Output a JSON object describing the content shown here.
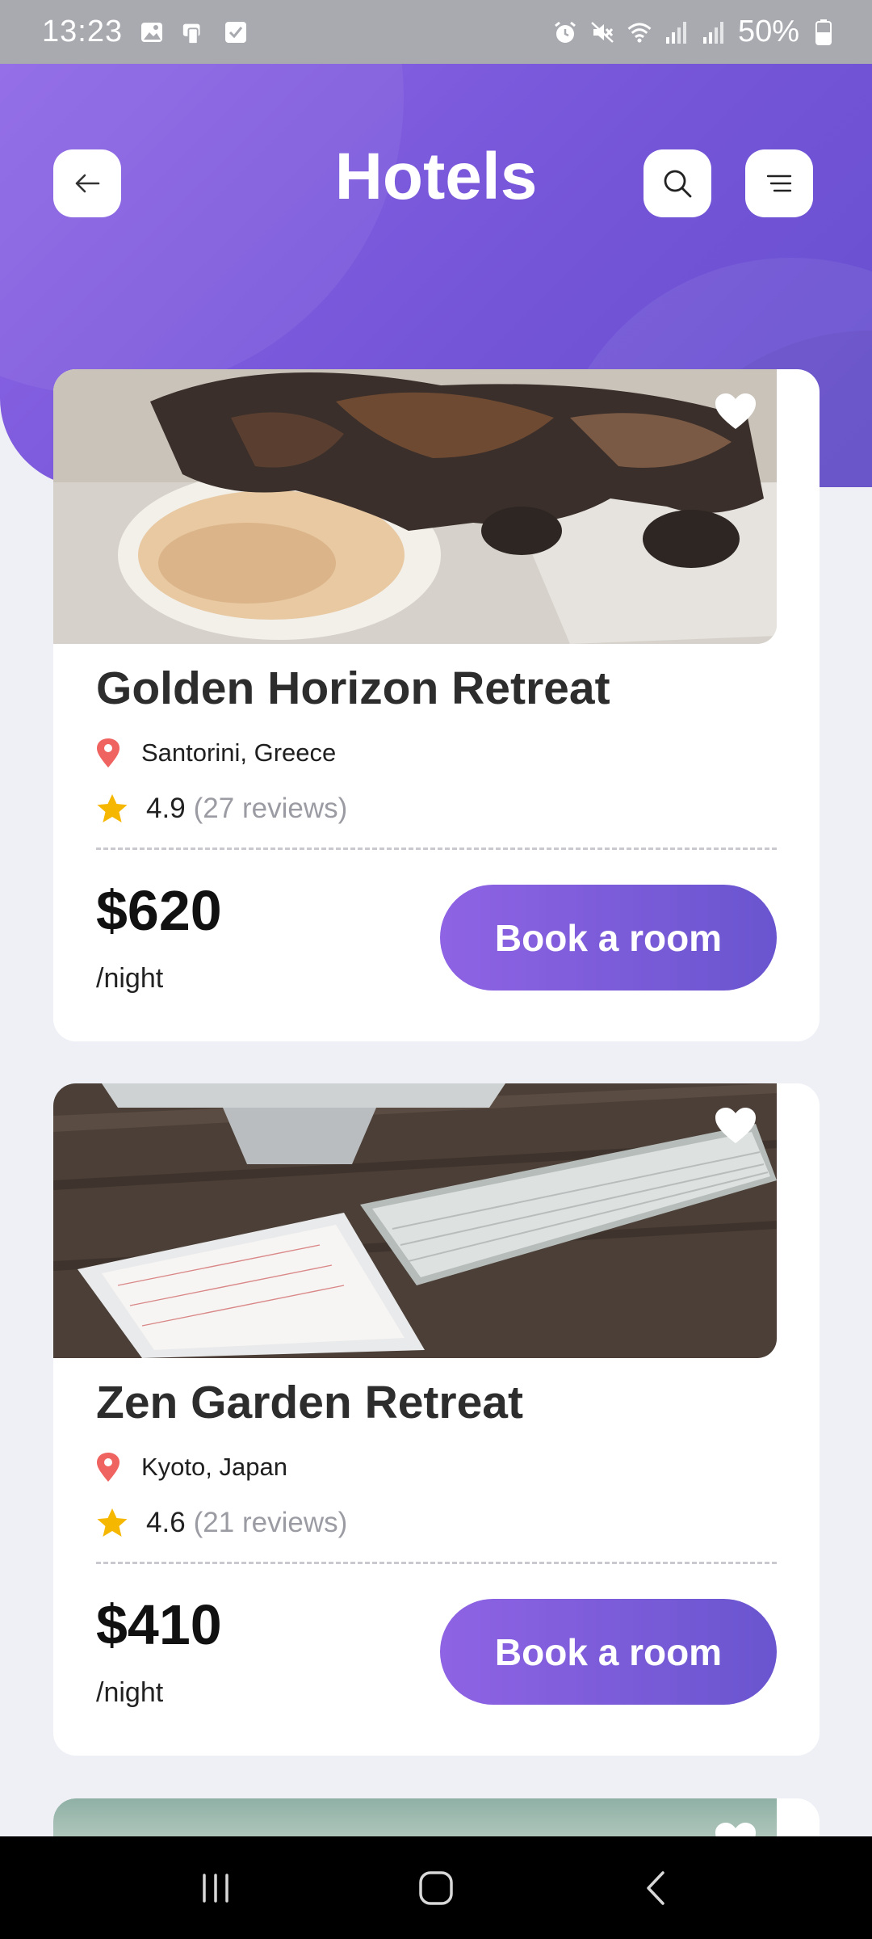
{
  "status_bar": {
    "time": "13:23",
    "battery": "50%",
    "left_icons": [
      "image-icon",
      "sim-card-icon",
      "checkbox-icon"
    ],
    "right_icons": [
      "alarm-icon",
      "mute-icon",
      "wifi-icon",
      "signal-icon",
      "signal-icon",
      "battery-icon"
    ]
  },
  "header": {
    "title": "Hotels",
    "back_icon": "arrow-left-icon",
    "search_icon": "search-icon",
    "menu_icon": "menu-icon",
    "gradient_colors": [
      "#8e66e6",
      "#6650cf"
    ]
  },
  "hotels": [
    {
      "name": "Golden Horizon Retreat",
      "location": "Santorini, Greece",
      "rating": "4.9",
      "reviews": "(27 reviews)",
      "price": "$620",
      "per": "/night",
      "cta": "Book a room",
      "image": "kitten eating from plate photo",
      "favorite": true
    },
    {
      "name": "Zen Garden Retreat",
      "location": "Kyoto, Japan",
      "rating": "4.6",
      "reviews": "(21 reviews)",
      "price": "$410",
      "per": "/night",
      "cta": "Book a room",
      "image": "tablet calendar and keyboard on desk photo",
      "favorite": true
    }
  ],
  "colors": {
    "accent": "#7a5ad9",
    "star": "#f6b700",
    "pin": "#ef6461",
    "background": "#eef0f6"
  },
  "nav_bar": {
    "icons": [
      "recent-apps-icon",
      "home-icon",
      "back-icon"
    ]
  }
}
